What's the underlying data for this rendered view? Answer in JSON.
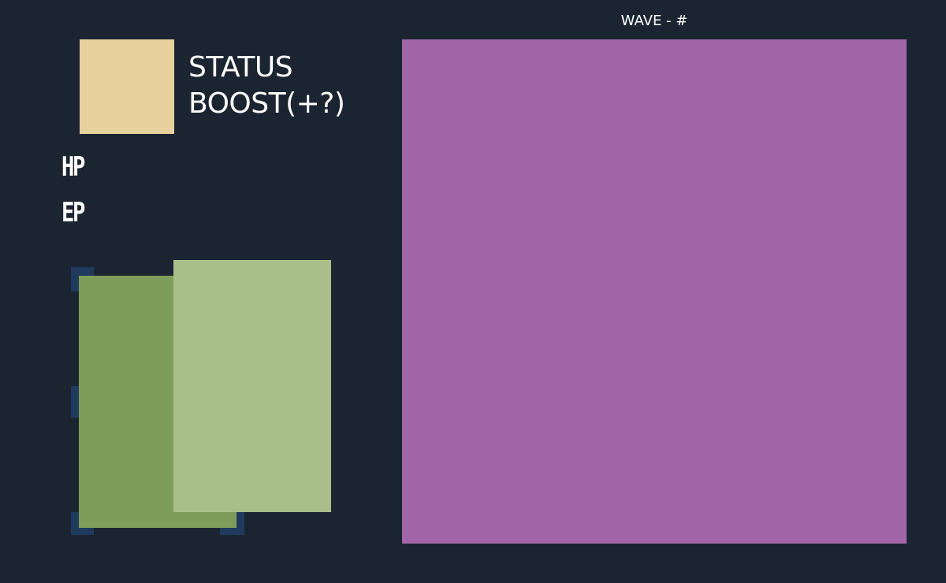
{
  "hud": {
    "wave_label": "WAVE - #"
  },
  "status": {
    "line1": "STATUS",
    "line2": "BOOST(+?)",
    "swatch_color": "#e8d19f"
  },
  "stats": {
    "hp_label": "HP",
    "ep_label": "EP"
  },
  "cards": {
    "back_color": "#7e9d5a",
    "front_color": "#a8bf8b",
    "slot_color": "#1f3a5c"
  },
  "field": {
    "color": "#a266a8"
  },
  "colors": {
    "background": "#1b2531"
  }
}
